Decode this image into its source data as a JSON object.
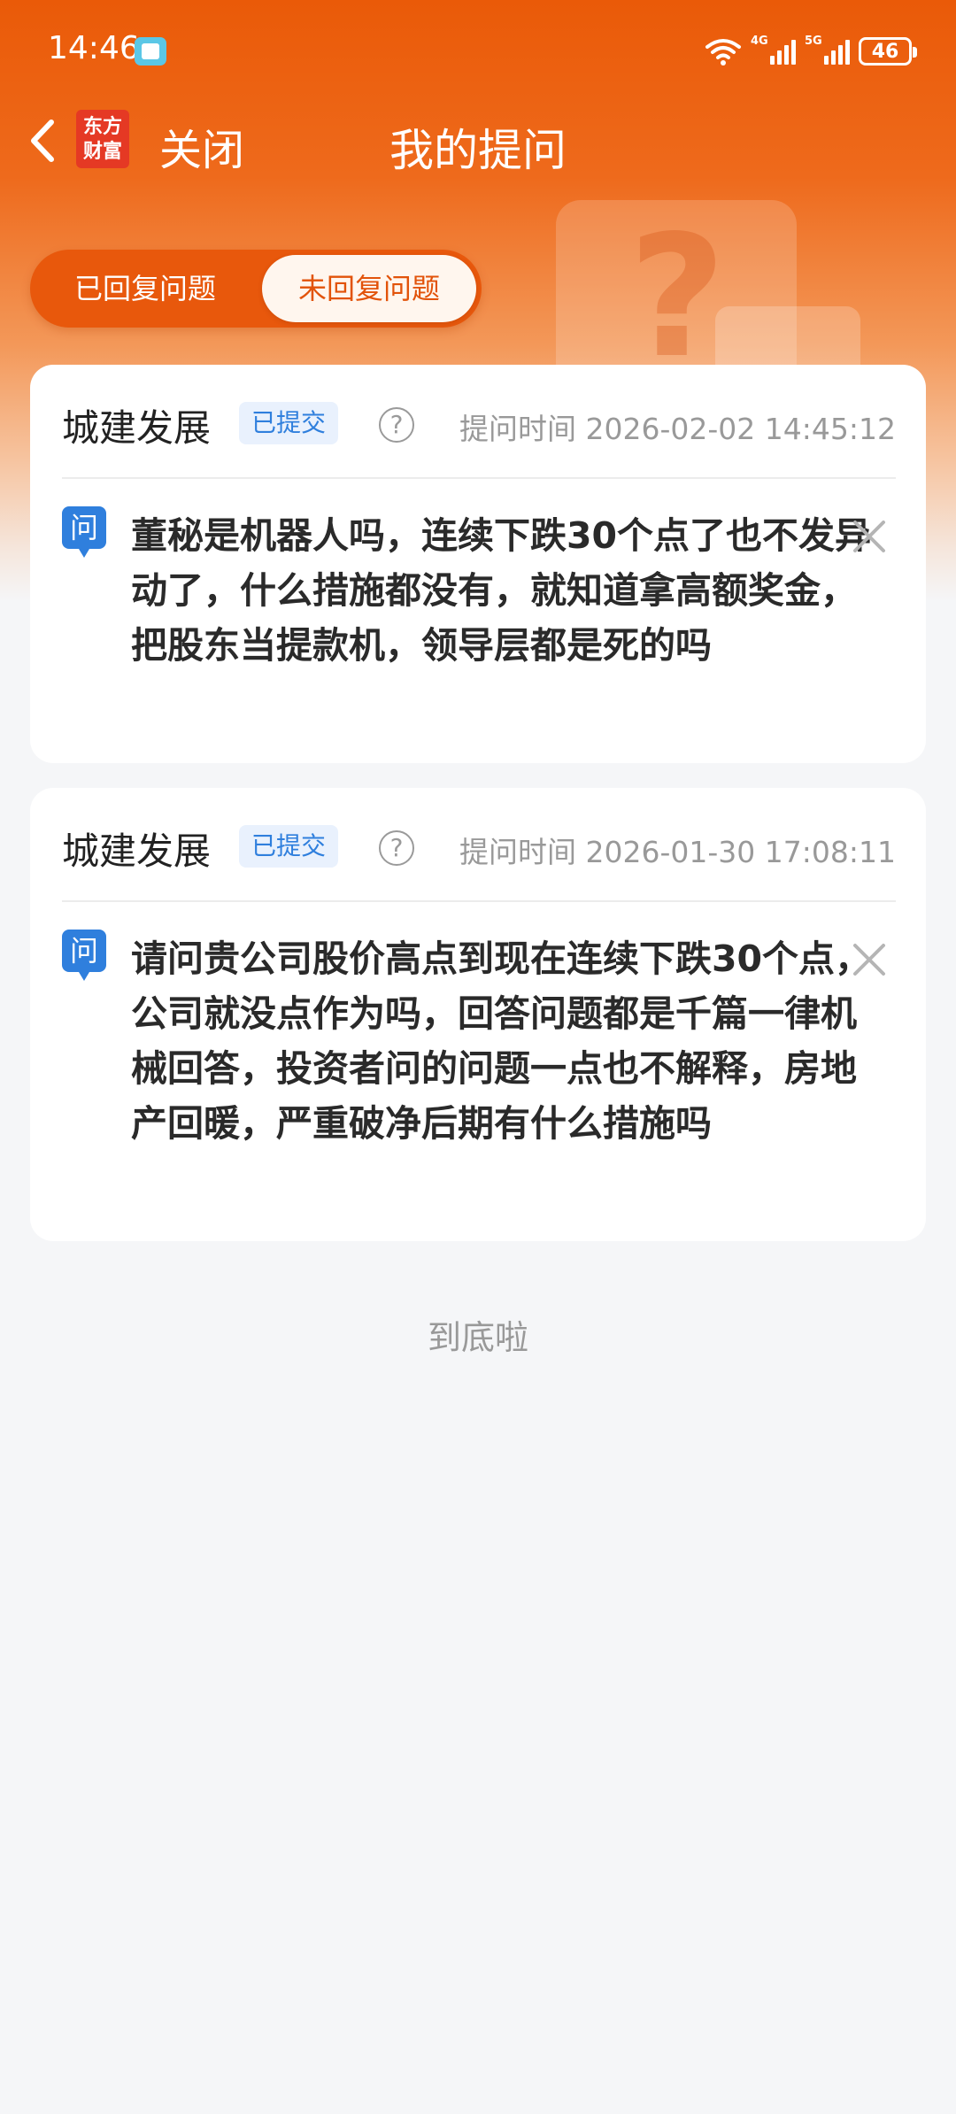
{
  "status_bar": {
    "time": "14:46",
    "battery": "46",
    "signal_tags": [
      "4G",
      "5G"
    ]
  },
  "nav": {
    "logo_text_line1": "东方",
    "logo_text_line2": "财富",
    "close_label": "关闭",
    "title": "我的提问"
  },
  "tabs": [
    {
      "label": "已回复问题",
      "active": false
    },
    {
      "label": "未回复问题",
      "active": true
    }
  ],
  "questions": [
    {
      "company": "城建发展",
      "status": "已提交",
      "time_label": "提问时间",
      "time": "2026-02-02 14:45:12",
      "q_badge": "问",
      "text": "董秘是机器人吗，连续下跌30个点了也不发异动了，什么措施都没有，就知道拿高额奖金，把股东当提款机，领导层都是死的吗"
    },
    {
      "company": "城建发展",
      "status": "已提交",
      "time_label": "提问时间",
      "time": "2026-01-30 17:08:11",
      "q_badge": "问",
      "text": "请问贵公司股价高点到现在连续下跌30个点，公司就没点作为吗，回答问题都是千篇一律机械回答，投资者问的问题一点也不解释，房地产回暖，严重破净后期有什么措施吗"
    }
  ],
  "footer": {
    "end_text": "到底啦"
  },
  "colors": {
    "brand_orange": "#ea5a08",
    "badge_blue": "#2f7fdd",
    "logo_red": "#e53924"
  }
}
